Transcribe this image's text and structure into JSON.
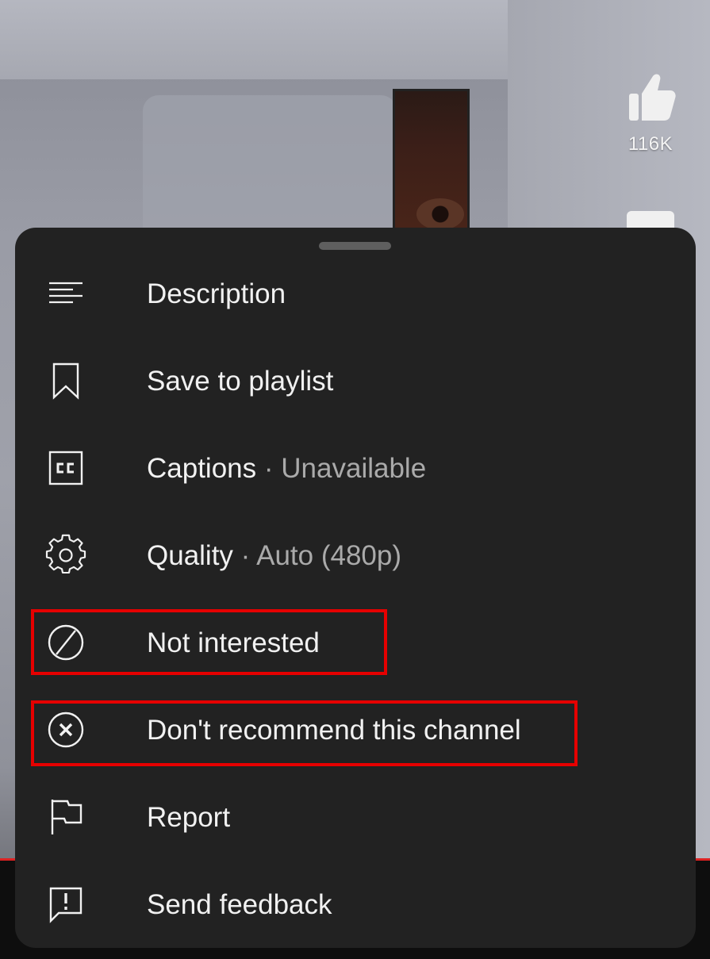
{
  "video": {
    "like_count": "116K"
  },
  "menu": {
    "items": [
      {
        "icon": "description-icon",
        "label": "Description",
        "sub": ""
      },
      {
        "icon": "bookmark-icon",
        "label": "Save to playlist",
        "sub": ""
      },
      {
        "icon": "captions-icon",
        "label": "Captions",
        "separator": "·",
        "sub": "Unavailable"
      },
      {
        "icon": "gear-icon",
        "label": "Quality",
        "separator": "·",
        "sub": "Auto (480p)"
      },
      {
        "icon": "block-icon",
        "label": "Not interested",
        "sub": ""
      },
      {
        "icon": "close-circle-icon",
        "label": "Don't recommend this channel",
        "sub": ""
      },
      {
        "icon": "flag-icon",
        "label": "Report",
        "sub": ""
      },
      {
        "icon": "feedback-icon",
        "label": "Send feedback",
        "sub": ""
      }
    ]
  },
  "colors": {
    "sheet_bg": "#222222",
    "text": "#f1f1f1",
    "secondary_text": "#aaaaaa",
    "highlight": "#e60000"
  }
}
